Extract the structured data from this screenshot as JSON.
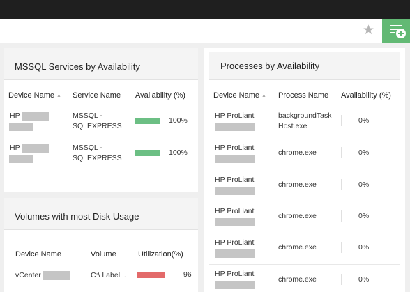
{
  "colors": {
    "availability_bar": "#6cbf84",
    "utilization_bar": "#e36a6a",
    "add_widget": "#62b974"
  },
  "toolbar": {
    "favorite_icon": "star-icon",
    "add_widget_icon": "add-widget-icon"
  },
  "mssql": {
    "title": "MSSQL Services by Availability",
    "columns": {
      "device": "Device Name",
      "service": "Service Name",
      "availability": "Availability (%)"
    },
    "rows": [
      {
        "device": "HP",
        "service_line1": "MSSQL -",
        "service_line2": "SQLEXPRESS",
        "availability": "100%",
        "availability_fraction": 1.0
      },
      {
        "device": "HP",
        "service_line1": "MSSQL -",
        "service_line2": "SQLEXPRESS",
        "availability": "100%",
        "availability_fraction": 1.0
      }
    ]
  },
  "processes": {
    "title": "Processes by Availability",
    "columns": {
      "device": "Device Name",
      "process": "Process Name",
      "availability": "Availability (%)"
    },
    "rows": [
      {
        "device": "HP ProLiant",
        "process_line1": "backgroundTask",
        "process_line2": "Host.exe",
        "availability": "0%"
      },
      {
        "device": "HP ProLiant",
        "process_line1": "chrome.exe",
        "availability": "0%"
      },
      {
        "device": "HP ProLiant",
        "process_line1": "chrome.exe",
        "availability": "0%"
      },
      {
        "device": "HP ProLiant",
        "process_line1": "chrome.exe",
        "availability": "0%"
      },
      {
        "device": "HP ProLiant",
        "process_line1": "chrome.exe",
        "availability": "0%"
      },
      {
        "device": "HP ProLiant",
        "process_line1": "chrome.exe",
        "availability": "0%"
      }
    ]
  },
  "volumes": {
    "title": "Volumes with most Disk Usage",
    "columns": {
      "device": "Device Name",
      "volume": "Volume",
      "utilization": "Utilization(%)"
    },
    "rows": [
      {
        "device": "vCenter",
        "volume": "C:\\ Label...",
        "utilization": "96",
        "utilization_fraction": 0.96
      }
    ]
  }
}
